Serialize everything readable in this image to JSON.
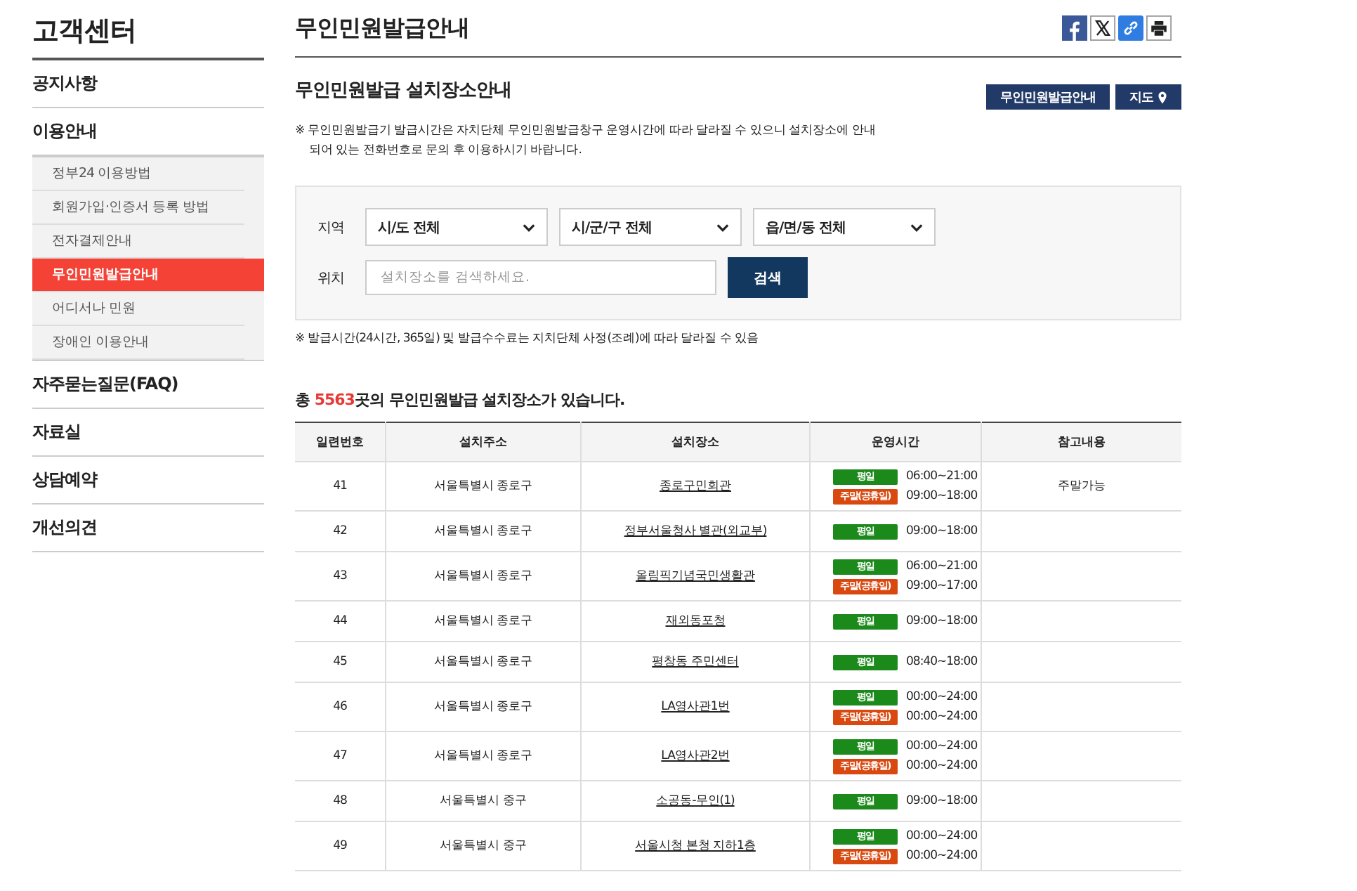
{
  "sidebar": {
    "title": "고객센터",
    "items": [
      {
        "label": "공지사항"
      },
      {
        "label": "이용안내",
        "children": [
          {
            "label": "정부24 이용방법",
            "selected": false
          },
          {
            "label": "회원가입·인증서 등록 방법",
            "selected": false
          },
          {
            "label": "전자결제안내",
            "selected": false
          },
          {
            "label": "무인민원발급안내",
            "selected": true
          },
          {
            "label": "어디서나 민원",
            "selected": false
          },
          {
            "label": "장애인 이용안내",
            "selected": false
          }
        ]
      },
      {
        "label": "자주묻는질문(FAQ)"
      },
      {
        "label": "자료실"
      },
      {
        "label": "상담예약"
      },
      {
        "label": "개선의견"
      }
    ]
  },
  "page_title": "무인민원발급안내",
  "share_icons": [
    {
      "kind": "facebook"
    },
    {
      "kind": "x"
    },
    {
      "kind": "link"
    },
    {
      "kind": "print"
    }
  ],
  "section_title": "무인민원발급 설치장소안내",
  "buttons": [
    {
      "label": "무인민원발급안내",
      "kind": "plain"
    },
    {
      "label": "지도",
      "kind": "map"
    }
  ],
  "notice": "※ 무인민원발급기 발급시간은 자치단체 무인민원발급창구 운영시간에 따라 달라질 수 있으니 설치장소에 안내되어 있는 전화번호로 문의 후 이용하시기 바랍니다.",
  "search": {
    "region_label": "지역",
    "selects": [
      "시/도 전체",
      "시/군/구 전체",
      "읍/면/동 전체"
    ],
    "location_label": "위치",
    "placeholder": "설치장소를 검색하세요.",
    "button": "검색"
  },
  "footnote": "※ 발급시간(24시간, 365일) 및 발급수수료는 지치단체 사정(조례)에 따라 달라질 수 있음",
  "total": {
    "before": "총 ",
    "count": "5563",
    "after": "곳의 무인민원발급 설치장소가 있습니다."
  },
  "table": {
    "columns": [
      "일련번호",
      "설치주소",
      "설치장소",
      "운영시간",
      "참고내용"
    ],
    "rows": [
      {
        "no": "41",
        "address": "서울특별시 종로구",
        "place": "종로구민회관",
        "hours": [
          {
            "kind": "weekday",
            "label": "평일",
            "time": "06:00~21:00"
          },
          {
            "kind": "weekend",
            "label": "주말(공휴일)",
            "time": "09:00~18:00"
          }
        ],
        "note": "주말가능"
      },
      {
        "no": "42",
        "address": "서울특별시 종로구",
        "place": "정부서울청사 별관(외교부)",
        "hours": [
          {
            "kind": "weekday",
            "label": "평일",
            "time": "09:00~18:00"
          }
        ]
      },
      {
        "no": "43",
        "address": "서울특별시 종로구",
        "place": "올림픽기념국민생활관",
        "hours": [
          {
            "kind": "weekday",
            "label": "평일",
            "time": "06:00~21:00"
          },
          {
            "kind": "weekend",
            "label": "주말(공휴일)",
            "time": "09:00~17:00"
          }
        ]
      },
      {
        "no": "44",
        "address": "서울특별시 종로구",
        "place": "재외동포청",
        "hours": [
          {
            "kind": "weekday",
            "label": "평일",
            "time": "09:00~18:00"
          }
        ]
      },
      {
        "no": "45",
        "address": "서울특별시 종로구",
        "place": "평창동 주민센터",
        "hours": [
          {
            "kind": "weekday",
            "label": "평일",
            "time": "08:40~18:00"
          }
        ]
      },
      {
        "no": "46",
        "address": "서울특별시 종로구",
        "place": "LA영사관1번",
        "hours": [
          {
            "kind": "weekday",
            "label": "평일",
            "time": "00:00~24:00"
          },
          {
            "kind": "weekend",
            "label": "주말(공휴일)",
            "time": "00:00~24:00"
          }
        ]
      },
      {
        "no": "47",
        "address": "서울특별시 종로구",
        "place": "LA영사관2번",
        "hours": [
          {
            "kind": "weekday",
            "label": "평일",
            "time": "00:00~24:00"
          },
          {
            "kind": "weekend",
            "label": "주말(공휴일)",
            "time": "00:00~24:00"
          }
        ]
      },
      {
        "no": "48",
        "address": "서울특별시 중구",
        "place": "소공동-무인(1)",
        "hours": [
          {
            "kind": "weekday",
            "label": "평일",
            "time": "09:00~18:00"
          }
        ]
      },
      {
        "no": "49",
        "address": "서울특별시 중구",
        "place": "서울시청 본청 지하1층",
        "hours": [
          {
            "kind": "weekday",
            "label": "평일",
            "time": "00:00~24:00"
          },
          {
            "kind": "weekend",
            "label": "주말(공휴일)",
            "time": "00:00~24:00"
          }
        ]
      }
    ]
  }
}
